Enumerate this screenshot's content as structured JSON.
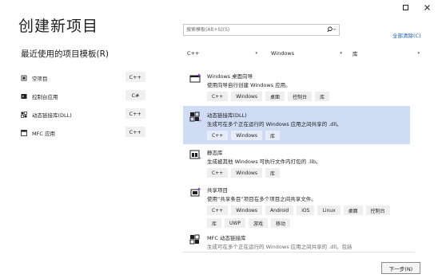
{
  "window": {
    "minimize_icon": "minimize-icon",
    "close_icon": "close-icon"
  },
  "page_title": "创建新项目",
  "recent": {
    "heading": "最近使用的项目模板(R)",
    "items": [
      {
        "label": "空项目",
        "lang": "C++",
        "icon": "empty-project-icon"
      },
      {
        "label": "控制台应用",
        "lang": "C#",
        "icon": "console-app-icon"
      },
      {
        "label": "动态链接库(DLL)",
        "lang": "C++",
        "icon": "dll-icon"
      },
      {
        "label": "MFC 应用",
        "lang": "C++",
        "icon": "mfc-app-icon"
      }
    ]
  },
  "search": {
    "placeholder": "搜索模板(Alt+S)(S)",
    "icon": "search-icon"
  },
  "clear_all": "全部清除(C)",
  "filters": {
    "language": "C++",
    "platform": "Windows",
    "type": "库"
  },
  "templates": [
    {
      "name": "Windows 桌面向导",
      "desc": "使用向导自行创建 Windows 应用。",
      "tags": [
        "C++",
        "Windows",
        "桌面",
        "控制台",
        "库"
      ]
    },
    {
      "name": "动态链接库(DLL)",
      "desc": "生成可在多个正在运行的 Windows 应用之间共享的 .dll。",
      "tags": [
        "C++",
        "Windows",
        "库"
      ]
    },
    {
      "name": "静态库",
      "desc": "生成被其他 Windows 可执行文件内打包的 .lib。",
      "tags": [
        "C++",
        "Windows",
        "库"
      ]
    },
    {
      "name": "共享项目",
      "desc": "使用“共享条目”项目在多个项目之间共享文件。",
      "tags": [
        "C++",
        "Windows",
        "Android",
        "iOS",
        "Linux",
        "桌面",
        "控制台",
        "库",
        "UWP",
        "游戏",
        "移动"
      ]
    },
    {
      "name": "MFC 动态链接库",
      "desc": "生成可在多个正在运行的 Windows 应用之间共享的 .dll。包括"
    }
  ],
  "next_button": "下一步(N)"
}
